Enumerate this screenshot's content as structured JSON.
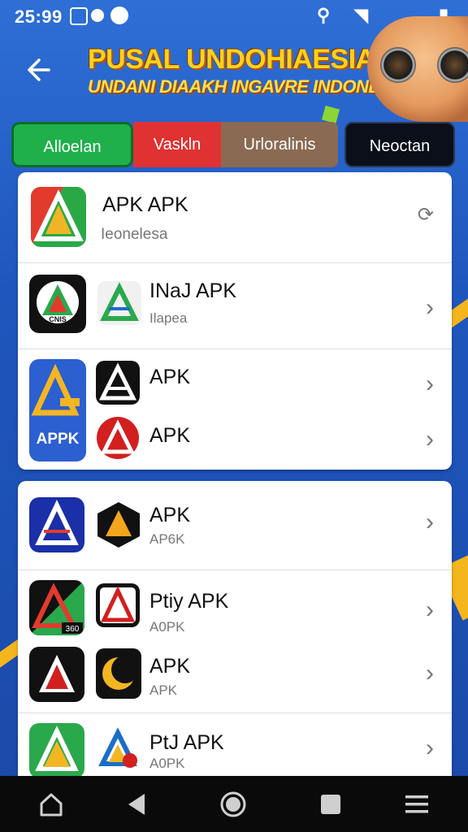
{
  "status_bar": {
    "time": "25:99"
  },
  "header": {
    "title": "PUSAL UNDOHIAESIA",
    "subtitle": "UNDANI DIAAKH INGAVRE INDONESO!"
  },
  "tabs": [
    {
      "label": "Alloelan"
    },
    {
      "label": "Vaskln"
    },
    {
      "label": "Urloralinis"
    },
    {
      "label": "Neoctan"
    }
  ],
  "apps": {
    "a1": {
      "name": "APK APK",
      "sub": "Ieonelesa"
    },
    "a2": {
      "name": "INaJ APK",
      "sub": "Ilapea",
      "icon_label": "CNIS"
    },
    "a3": {
      "name": "APK",
      "icon_label": "APPK"
    },
    "a4": {
      "name": "APK"
    },
    "a5": {
      "name": "APK",
      "sub": "AP6K"
    },
    "a6": {
      "name": "Ptiy APK",
      "sub": "A0PK",
      "icon_label": "360"
    },
    "a7": {
      "name": "APK",
      "sub": "APK"
    },
    "a8": {
      "name": "PtJ APK",
      "sub": "A0PK"
    }
  },
  "colors": {
    "tab_green": "#1fb04b",
    "tab_red": "#e03232",
    "tab_brown": "#8a6a52",
    "tab_black": "#0b0f1a",
    "accent_yellow": "#ffd21c"
  }
}
